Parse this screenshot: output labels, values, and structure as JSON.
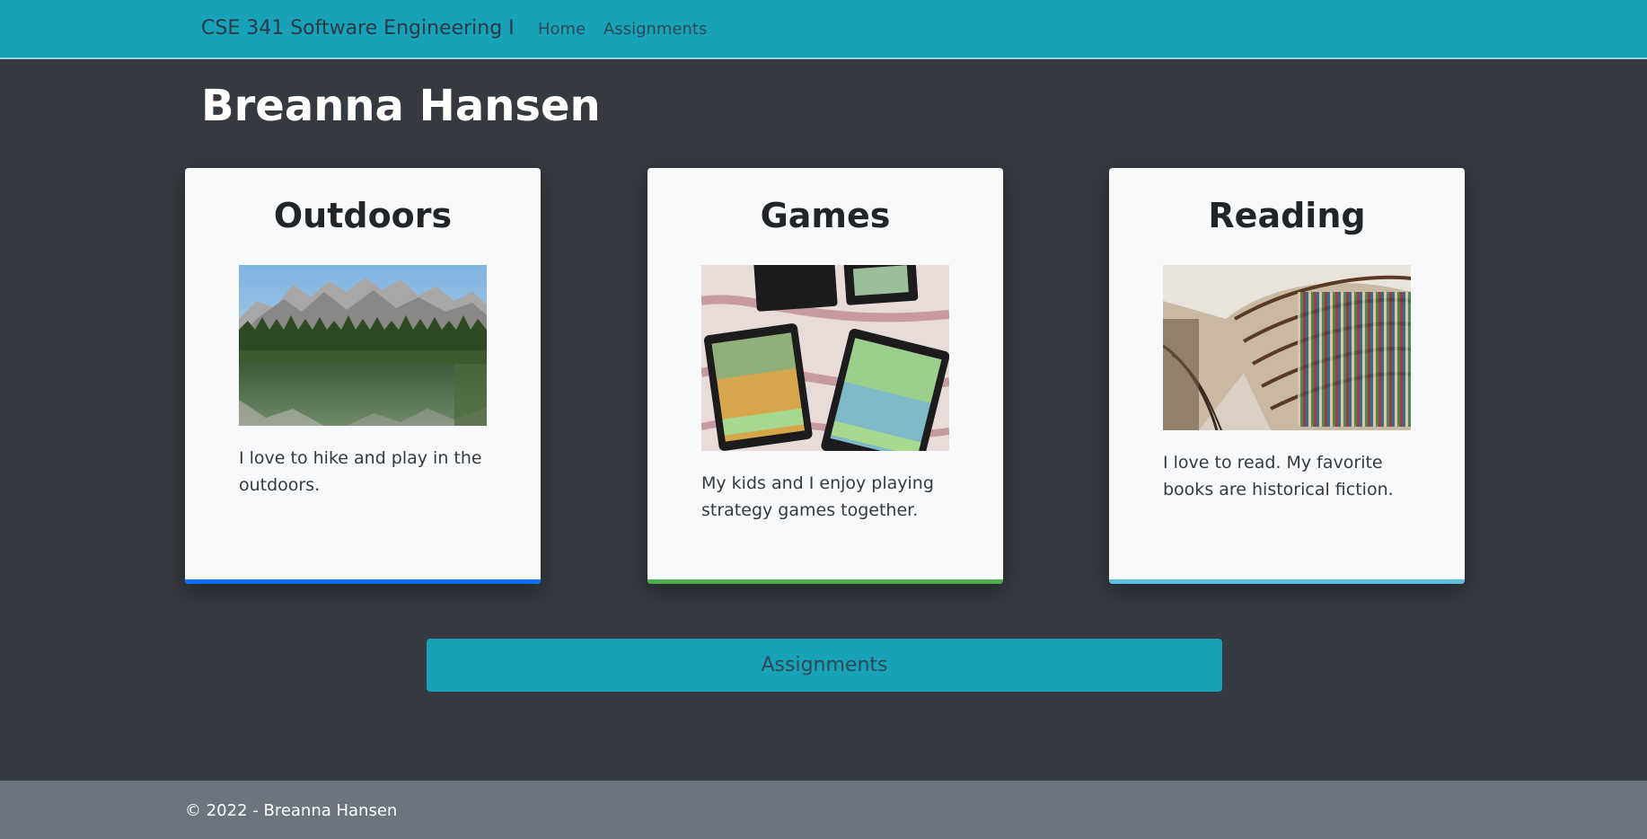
{
  "navbar": {
    "brand": "CSE 341 Software Engineering I",
    "links": [
      "Home",
      "Assignments"
    ],
    "color": "#17a2b8"
  },
  "page_title": "Breanna Hansen",
  "cards": [
    {
      "title": "Outdoors",
      "image": "mountain-lake-forest-photo",
      "text": "I love to hike and play in the outdoors.",
      "accent": "#0d6efd"
    },
    {
      "title": "Games",
      "image": "board-game-cards-photo",
      "text": "My kids and I enjoy playing strategy games together.",
      "accent": "#4cae4c"
    },
    {
      "title": "Reading",
      "image": "library-bookshelves-photo",
      "text": "I love to read. My favorite books are historical fiction.",
      "accent": "#5bc0de"
    }
  ],
  "assignments_button": "Assignments",
  "footer": {
    "text": "©  2022 - Breanna Hansen"
  }
}
